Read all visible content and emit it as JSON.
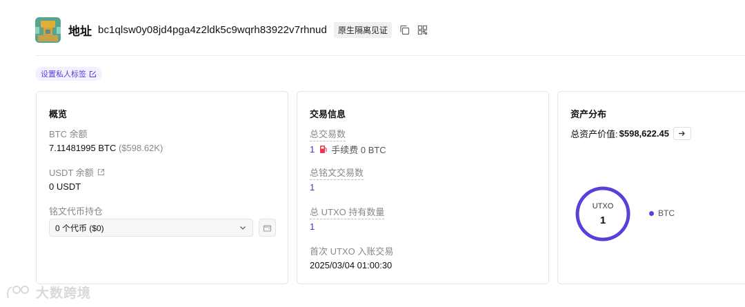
{
  "header": {
    "label": "地址",
    "address": "bc1qlsw0y08jd4pga4z2ldk5c9wqrh83922v7rhnud",
    "badge": "原生隔离见证",
    "icons": [
      "copy-icon",
      "qr-code-icon"
    ]
  },
  "tag_button": {
    "label": "设置私人标签",
    "icon": "edit-icon"
  },
  "overview": {
    "title": "概览",
    "btc_label": "BTC 余额",
    "btc_value": "7.11481995 BTC",
    "btc_usd": "($598.62K)",
    "usdt_label": "USDT 余额",
    "usdt_value": "0  USDT",
    "inscription_label": "铭文代币持仓",
    "inscription_select": "0 个代币 ($0)"
  },
  "transactions": {
    "title": "交易信息",
    "total_label": "总交易数",
    "total_value": "1",
    "fee_text": "手续费 0 BTC",
    "inscription_label": "总铭文交易数",
    "inscription_value": "1",
    "utxo_label": "总 UTXO 持有数量",
    "utxo_value": "1",
    "first_label": "首次 UTXO 入账交易",
    "first_value": "2025/03/04 01:00:30"
  },
  "assets": {
    "title": "资产分布",
    "total_label": "总资产价值:",
    "total_value": "$598,622.45",
    "donut_label": "UTXO",
    "donut_value": "1",
    "legend": [
      {
        "name": "BTC",
        "color": "#5b3fd9"
      }
    ]
  },
  "colors": {
    "accent": "#5b3fd9",
    "fee": "#e5384f"
  },
  "watermark": "大数跨境"
}
